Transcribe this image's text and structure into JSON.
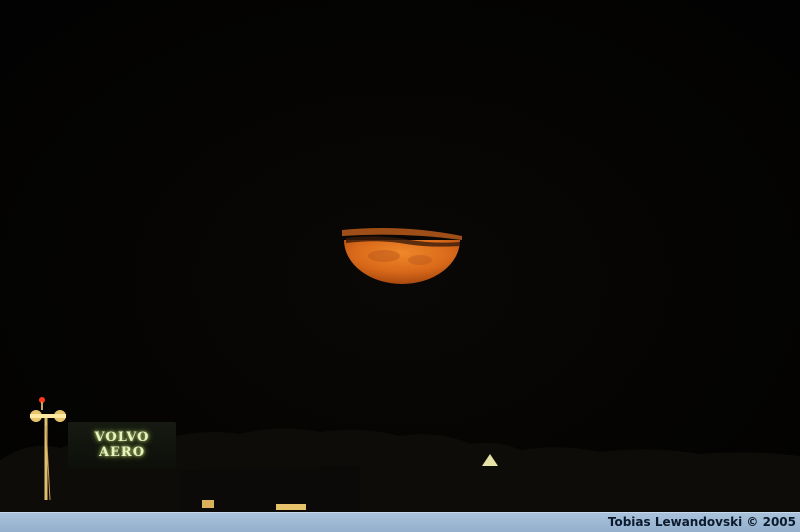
{
  "photo": {
    "sign_line1": "VOLVO",
    "sign_line2": "AERO",
    "sky_color": "#030303",
    "moon_color": "#e0741c",
    "sign_glow_color": "#dff0b0"
  },
  "footer": {
    "credit": "Tobias Lewandovski © 2005",
    "bar_color": "#a3bcd7"
  }
}
